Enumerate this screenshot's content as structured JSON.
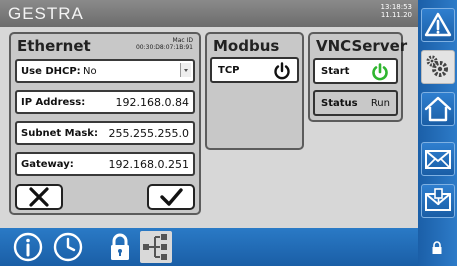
{
  "header": {
    "brand": "GESTRA",
    "time": "13:18:53",
    "date": "11.11.20"
  },
  "ethernet": {
    "title": "Ethernet",
    "mac_label": "Mac ID",
    "mac_value": "00:30:D8:07:1B:91",
    "use_dhcp_label": "Use DHCP:",
    "use_dhcp_value": "No",
    "ip_label": "IP Address:",
    "ip_value": "192.168.0.84",
    "subnet_label": "Subnet Mask:",
    "subnet_value": "255.255.255.0",
    "gateway_label": "Gateway:",
    "gateway_value": "192.168.0.251"
  },
  "modbus": {
    "title": "Modbus",
    "tcp_label": "TCP"
  },
  "vnc": {
    "title": "VNCServer",
    "start_label": "Start",
    "status_label": "Status",
    "status_value": "Run"
  },
  "colors": {
    "power_green": "#2fb52f",
    "sidebar_blue": "#1f66b0",
    "header_gray": "#7a7a7a"
  },
  "icons": {
    "sidebar": [
      "warning-icon",
      "settings-gears-icon",
      "home-icon",
      "envelope-icon",
      "mail-export-icon"
    ],
    "bottom": [
      "info-icon",
      "clock-icon",
      "lock-icon",
      "network-icon",
      "lock-small-icon"
    ]
  }
}
